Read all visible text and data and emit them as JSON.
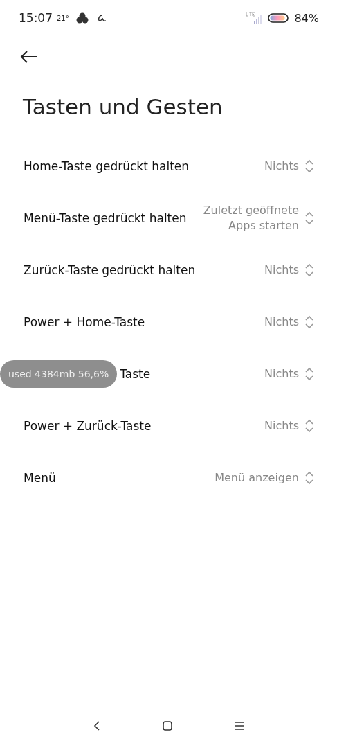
{
  "status_bar": {
    "time": "15:07",
    "temperature": "21°",
    "battery": "84%"
  },
  "title": "Tasten und Gesten",
  "settings": [
    {
      "label": "Home-Taste gedrückt halten",
      "value": "Nichts"
    },
    {
      "label": "Menü-Taste gedrückt halten",
      "value": "Zuletzt geöffnete Apps starten"
    },
    {
      "label": "Zurück-Taste gedrückt halten",
      "value": "Nichts"
    },
    {
      "label": "Power + Home-Taste",
      "value": "Nichts"
    },
    {
      "label": "Taste",
      "value": "Nichts",
      "overlay": "used 4384mb 56,6%"
    },
    {
      "label": "Power + Zurück-Taste",
      "value": "Nichts"
    },
    {
      "label": "Menü",
      "value": "Menü anzeigen"
    }
  ]
}
